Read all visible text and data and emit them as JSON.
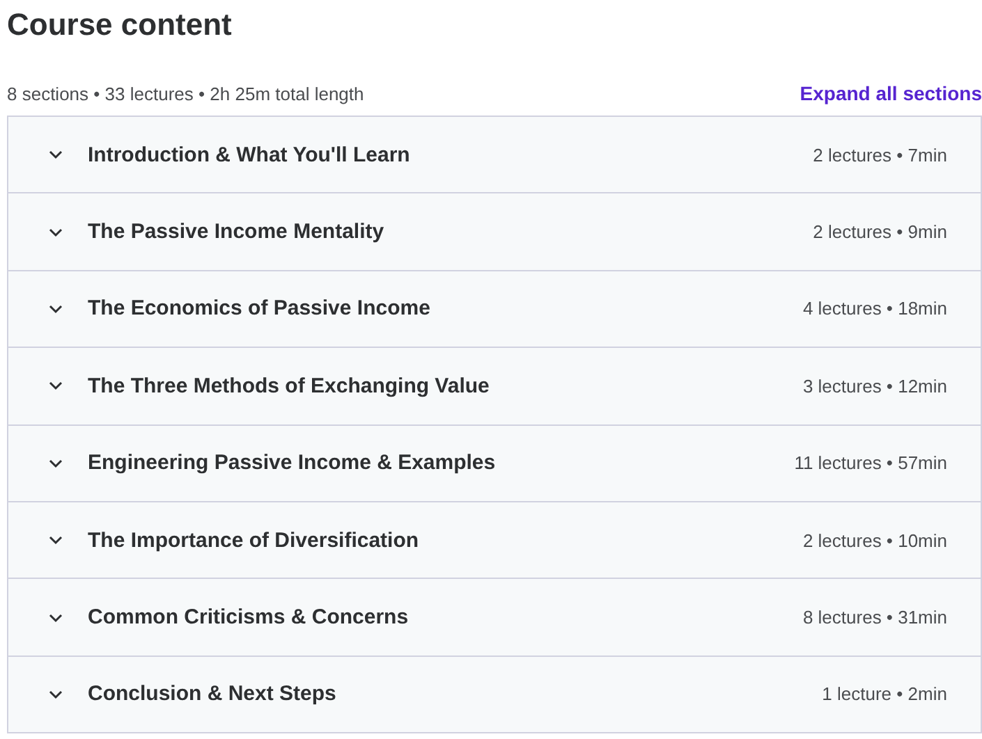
{
  "title": "Course content",
  "summary": "8 sections • 33 lectures • 2h 25m total length",
  "expand_all": "Expand all sections",
  "sections": [
    {
      "title": "Introduction & What You'll Learn",
      "meta": "2 lectures • 7min",
      "expanded": false
    },
    {
      "title": "The Passive Income Mentality",
      "meta": "2 lectures • 9min",
      "expanded": false
    },
    {
      "title": "The Economics of Passive Income",
      "meta": "4 lectures • 18min",
      "expanded": false
    },
    {
      "title": "The Three Methods of Exchanging Value",
      "meta": "3 lectures • 12min",
      "expanded": false
    },
    {
      "title": "Engineering Passive Income & Examples",
      "meta": "11 lectures • 57min",
      "expanded": false
    },
    {
      "title": "The Importance of Diversification",
      "meta": "2 lectures • 10min",
      "expanded": false
    },
    {
      "title": "Common Criticisms & Concerns",
      "meta": "8 lectures • 31min",
      "expanded": false
    },
    {
      "title": "Conclusion & Next Steps",
      "meta": "1 lecture • 2min",
      "expanded": false
    }
  ]
}
